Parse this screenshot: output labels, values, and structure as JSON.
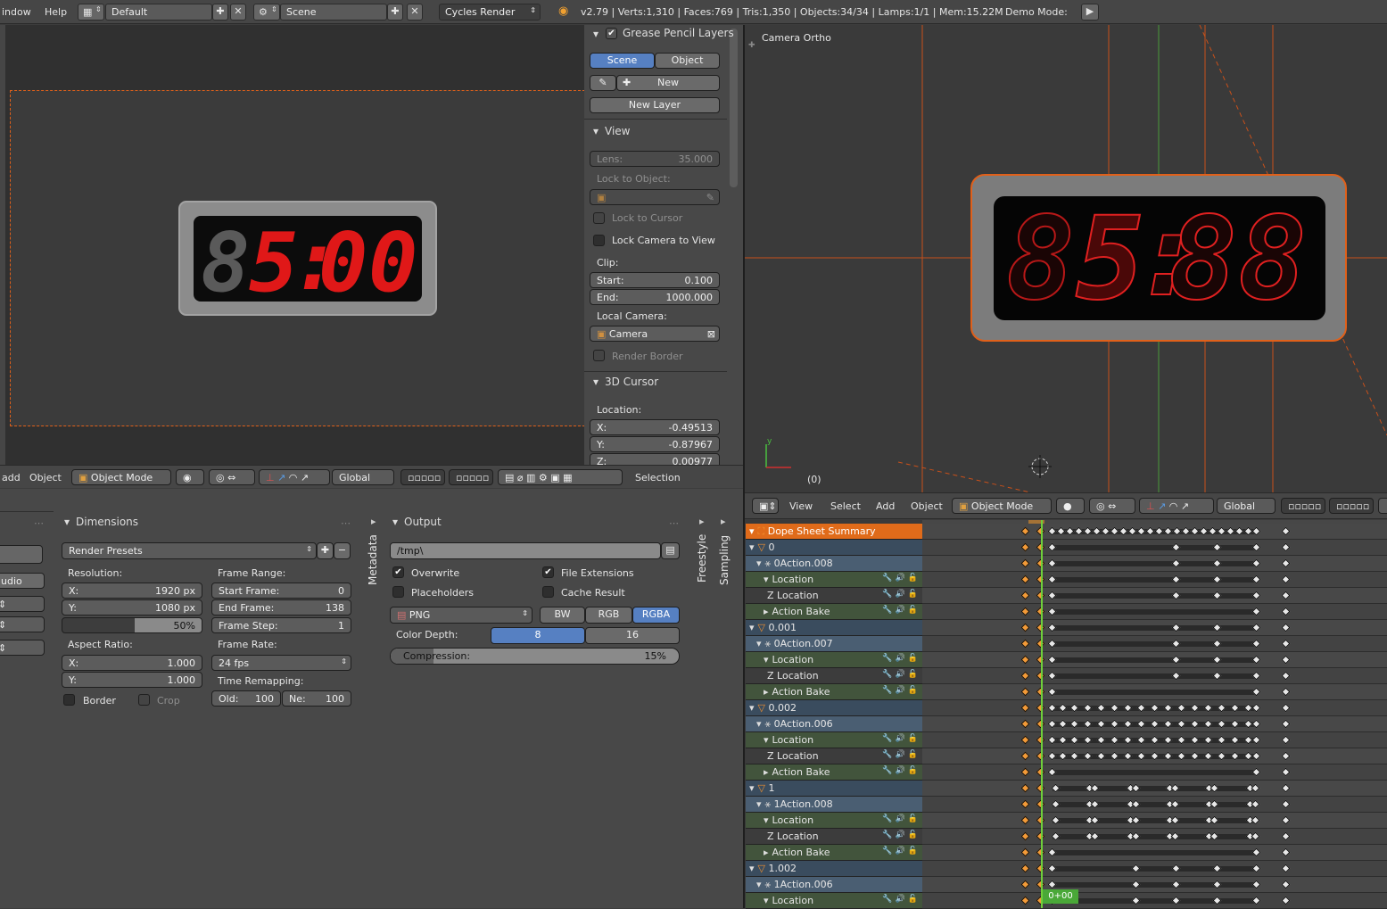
{
  "topbar": {
    "menu_window": "indow",
    "menu_help": "Help",
    "screen_layout": "Default",
    "scene": "Scene",
    "render_engine": "Cycles Render",
    "stats": "v2.79 | Verts:1,310 | Faces:769 | Tris:1,350 | Objects:34/34 | Lamps:1/1 | Mem:15.22M",
    "demo_mode": "Demo Mode:"
  },
  "left_viewport": {
    "clock_digits": "85:00",
    "header": {
      "menu_add": "add",
      "menu_object": "Object",
      "mode": "Object Mode",
      "orientation": "Global",
      "selection": "Selection"
    }
  },
  "npanel": {
    "grease_pencil": {
      "title": "Grease Pencil Layers",
      "scene_tab": "Scene",
      "object_tab": "Object",
      "new_label": "New",
      "new_layer_label": "New Layer"
    },
    "view": {
      "title": "View",
      "lens_label": "Lens:",
      "lens_value": "35.000",
      "lock_to_object_label": "Lock to Object:",
      "lock_to_cursor": "Lock to Cursor",
      "lock_camera_to_view": "Lock Camera to View",
      "clip_label": "Clip:",
      "start_label": "Start:",
      "start_value": "0.100",
      "end_label": "End:",
      "end_value": "1000.000",
      "local_camera_label": "Local Camera:",
      "local_camera_value": "Camera",
      "render_border": "Render Border"
    },
    "cursor": {
      "title": "3D Cursor",
      "location_label": "Location:",
      "x_label": "X:",
      "x_value": "-0.49513",
      "y_label": "Y:",
      "y_value": "-0.87967",
      "z_label": "Z:",
      "z_value": "0.00977"
    }
  },
  "right_viewport": {
    "view_name": "Camera Ortho",
    "clock_digits": "85:88",
    "frame_label": "(0)",
    "header": {
      "menu_view": "View",
      "menu_select": "Select",
      "menu_add": "Add",
      "menu_object": "Object",
      "mode": "Object Mode",
      "orientation": "Global"
    }
  },
  "properties": {
    "left_stub": {
      "audio": "udio"
    },
    "dimensions": {
      "title": "Dimensions",
      "render_presets": "Render Presets",
      "resolution_label": "Resolution:",
      "res_x_label": "X:",
      "res_x_value": "1920 px",
      "res_y_label": "Y:",
      "res_y_value": "1080 px",
      "res_percent": "50%",
      "aspect_label": "Aspect Ratio:",
      "asp_x_label": "X:",
      "asp_x_value": "1.000",
      "asp_y_label": "Y:",
      "asp_y_value": "1.000",
      "border": "Border",
      "crop": "Crop",
      "frame_range_label": "Frame Range:",
      "start_frame_label": "Start Frame:",
      "start_frame_value": "0",
      "end_frame_label": "End Frame:",
      "end_frame_value": "138",
      "frame_step_label": "Frame Step:",
      "frame_step_value": "1",
      "frame_rate_label": "Frame Rate:",
      "frame_rate_value": "24 fps",
      "time_remap_label": "Time Remapping:",
      "old_label": "Old:",
      "old_value": "100",
      "new_label": "Ne:",
      "new_value": "100"
    },
    "metadata_tab": "Metadata",
    "output": {
      "title": "Output",
      "path": "/tmp\\",
      "overwrite": "Overwrite",
      "file_extensions": "File Extensions",
      "placeholders": "Placeholders",
      "cache_result": "Cache Result",
      "format": "PNG",
      "bw": "BW",
      "rgb": "RGB",
      "rgba": "RGBA",
      "color_depth_label": "Color Depth:",
      "depth_8": "8",
      "depth_16": "16",
      "compression_label": "Compression:",
      "compression_value": "15%",
      "compression_fraction": 0.15
    },
    "freestyle_tab": "Freestyle",
    "sampling_tab": "Sampling"
  },
  "dopesheet": {
    "current_frame_label": "0+00",
    "channels": [
      {
        "label": "Dope Sheet Summary",
        "kind": "sum",
        "indent": 0
      },
      {
        "label": "0",
        "kind": "obj",
        "indent": 0
      },
      {
        "label": "0Action.008",
        "kind": "act",
        "indent": 1
      },
      {
        "label": "Location",
        "kind": "fc",
        "indent": 2
      },
      {
        "label": "Z Location",
        "kind": "fcurve",
        "indent": 2
      },
      {
        "label": "Action Bake",
        "kind": "fc",
        "indent": 2
      },
      {
        "label": "0.001",
        "kind": "obj",
        "indent": 0
      },
      {
        "label": "0Action.007",
        "kind": "act",
        "indent": 1
      },
      {
        "label": "Location",
        "kind": "fc",
        "indent": 2
      },
      {
        "label": "Z Location",
        "kind": "fcurve",
        "indent": 2
      },
      {
        "label": "Action Bake",
        "kind": "fc",
        "indent": 2
      },
      {
        "label": "0.002",
        "kind": "obj",
        "indent": 0
      },
      {
        "label": "0Action.006",
        "kind": "act",
        "indent": 1
      },
      {
        "label": "Location",
        "kind": "fc",
        "indent": 2
      },
      {
        "label": "Z Location",
        "kind": "fcurve",
        "indent": 2
      },
      {
        "label": "Action Bake",
        "kind": "fc",
        "indent": 2
      },
      {
        "label": "1",
        "kind": "obj",
        "indent": 0
      },
      {
        "label": "1Action.008",
        "kind": "act",
        "indent": 1
      },
      {
        "label": "Location",
        "kind": "fc",
        "indent": 2
      },
      {
        "label": "Z Location",
        "kind": "fcurve",
        "indent": 2
      },
      {
        "label": "Action Bake",
        "kind": "fc",
        "indent": 2
      },
      {
        "label": "1.002",
        "kind": "obj",
        "indent": 0
      },
      {
        "label": "1Action.006",
        "kind": "act",
        "indent": 1
      },
      {
        "label": "Location",
        "kind": "fc",
        "indent": 2
      }
    ]
  },
  "colors": {
    "accent_blue": "#5680c2",
    "selection_orange": "#e06b1a",
    "digit_red": "#e01818",
    "frame_line_green": "#6fcf3a"
  }
}
